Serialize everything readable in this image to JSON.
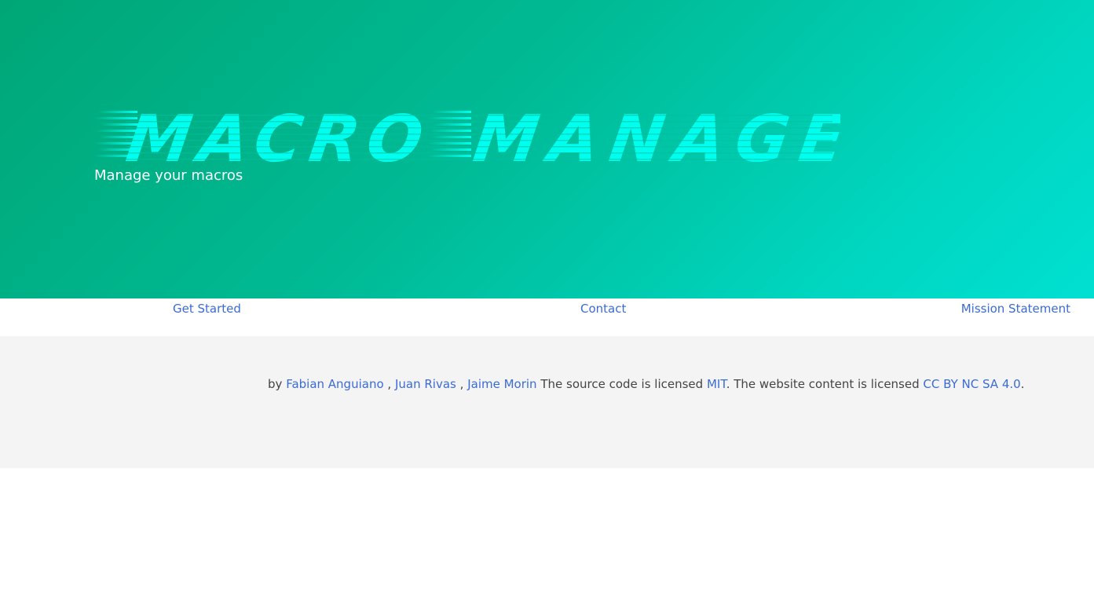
{
  "colors": {
    "hero_gradient_start": "#00a676",
    "hero_gradient_end": "#00e0d2",
    "logo_color": "#00ffee",
    "link_color": "#3b6bd6",
    "footer_background": "#f4f4f4",
    "footer_text": "#444444"
  },
  "hero": {
    "logo_text": "Macro Manage",
    "tagline": "Manage your macros"
  },
  "nav": {
    "items": [
      {
        "label": "Get Started"
      },
      {
        "label": "Contact"
      },
      {
        "label": "Mission Statement"
      }
    ]
  },
  "footer": {
    "by": "by",
    "authors": [
      "Fabian Anguiano",
      "Juan Rivas",
      "Jaime Morin"
    ],
    "separator": ",",
    "source_text": "The source code is licensed",
    "source_license": "MIT",
    "content_text": ". The website content is licensed",
    "content_license": "CC BY NC SA 4.0",
    "end": "."
  }
}
